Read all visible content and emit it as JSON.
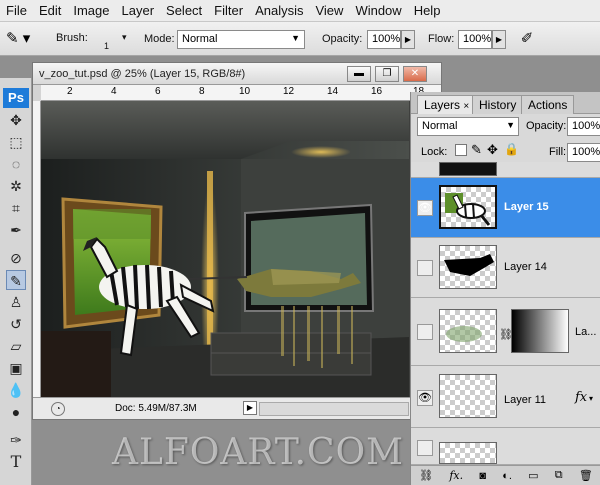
{
  "menu": [
    "File",
    "Edit",
    "Image",
    "Layer",
    "Select",
    "Filter",
    "Analysis",
    "View",
    "Window",
    "Help"
  ],
  "options": {
    "brush_label": "Brush:",
    "brush_size": "1",
    "mode_label": "Mode:",
    "mode_value": "Normal",
    "opacity_label": "Opacity:",
    "opacity_value": "100%",
    "flow_label": "Flow:",
    "flow_value": "100%"
  },
  "toolbox": {
    "logo": "Ps"
  },
  "document": {
    "title": "v_zoo_tut.psd @ 25% (Layer 15, RGB/8#)",
    "ruler_marks": [
      "2",
      "4",
      "6",
      "8",
      "10",
      "12",
      "14",
      "16",
      "18"
    ],
    "status": "Doc: 5.49M/87.3M"
  },
  "layers_panel": {
    "tabs": [
      "Layers",
      "History",
      "Actions"
    ],
    "blend_mode": "Normal",
    "opacity_label": "Opacity:",
    "opacity_value": "100%",
    "lock_label": "Lock:",
    "fill_label": "Fill:",
    "fill_value": "100%",
    "layers": [
      {
        "name": "Layer 15",
        "visible": true,
        "selected": true
      },
      {
        "name": "Layer 14",
        "visible": false,
        "selected": false
      },
      {
        "name": "La...",
        "visible": false,
        "selected": false
      },
      {
        "name": "Layer 11",
        "visible": true,
        "selected": false,
        "fx": "fx"
      }
    ]
  },
  "colors": {
    "selection": "#3b8de8",
    "ps_blue": "#1e7bd9"
  },
  "watermark": "ALFOART.COM"
}
